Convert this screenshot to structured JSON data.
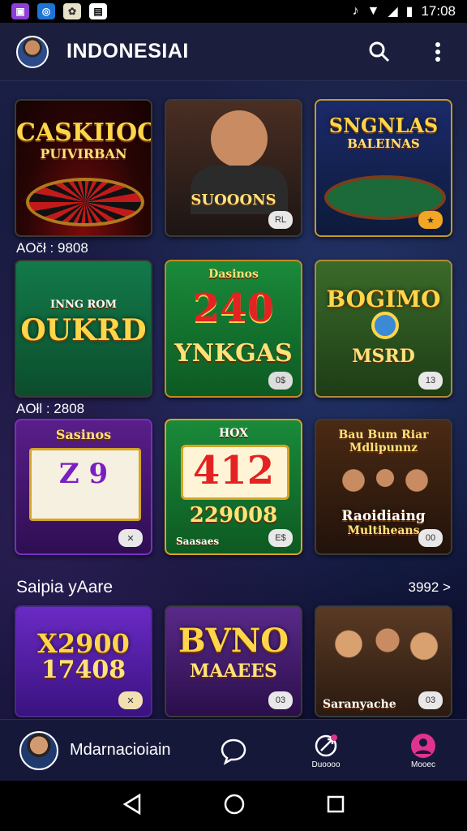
{
  "status_bar": {
    "apps": [
      "app-icon",
      "browser-icon",
      "settings-icon",
      "bag-icon"
    ],
    "time": "17:08"
  },
  "app_bar": {
    "title": "INDONESIAI"
  },
  "games": [
    {
      "title": "CASKIIOO",
      "sub": "PUIVIRBAN",
      "badge": ""
    },
    {
      "title": "",
      "sub": "SUOOONS",
      "badge": "RL"
    },
    {
      "title": "SNGNLAS",
      "sub": "BALEINAS",
      "badge": ""
    },
    {
      "title": "OUKRD",
      "sub": "INNG ROM",
      "badge": ""
    },
    {
      "title": "240",
      "sub": "YNKGAS",
      "badge": "0$",
      "top": "Dasinos"
    },
    {
      "title": "BOGIMO",
      "sub": "MSRD",
      "badge": "13"
    },
    {
      "title": "Z 9",
      "sub": "Sasinos",
      "badge": ""
    },
    {
      "title": "412",
      "sub": "229008",
      "badge": "E$",
      "top": "HOX",
      "foot": "Saasaes"
    },
    {
      "title": "Raoidiaing",
      "sub": "Multiheans",
      "badge": "00",
      "top": "Bau Bum Riar Mdlipunnz"
    },
    {
      "title": "X2900",
      "sub": "17408",
      "badge": ""
    },
    {
      "title": "BVNO",
      "sub": "MAAEES",
      "badge": "03"
    },
    {
      "title": "",
      "sub": "Saranyache",
      "badge": "03"
    }
  ],
  "captions": {
    "row1": "AOčł : 9808",
    "row2": "AOłl : 2808"
  },
  "section": {
    "title": "Saipia yAare",
    "more": "3992 >"
  },
  "bottom_nav": {
    "name": "Mdarnacioiain",
    "item2_label": "Duoooo",
    "item3_label": "Mooec"
  },
  "colors": {
    "accent": "#e0338f",
    "background": "#0c0f2a",
    "appbar": "#1b1e3c"
  }
}
